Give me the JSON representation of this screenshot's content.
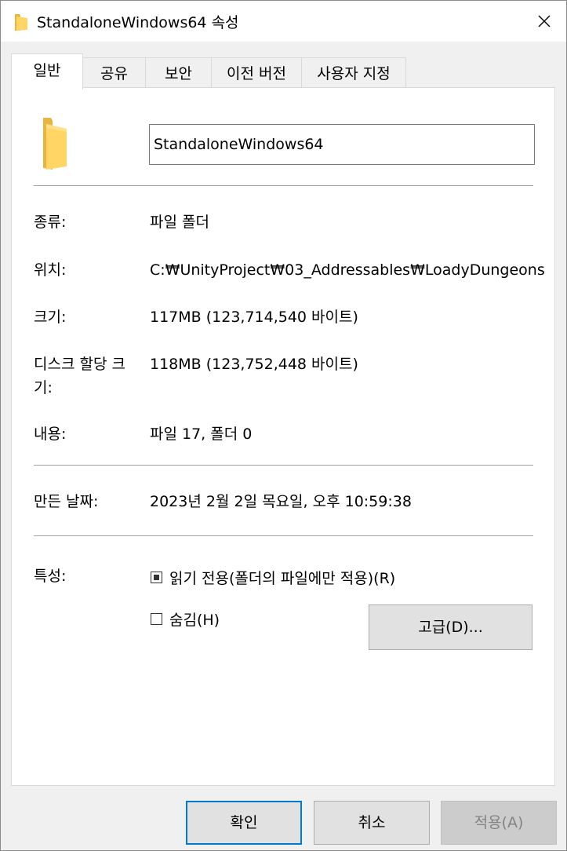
{
  "window": {
    "title": "StandaloneWindows64 속성",
    "close_icon": "close-icon"
  },
  "tabs": [
    {
      "label": "일반",
      "active": true
    },
    {
      "label": "공유",
      "active": false
    },
    {
      "label": "보안",
      "active": false
    },
    {
      "label": "이전 버전",
      "active": false
    },
    {
      "label": "사용자 지정",
      "active": false
    }
  ],
  "general": {
    "folder_icon": "folder-icon",
    "name_value": "StandaloneWindows64",
    "type_label": "종류:",
    "type_value": "파일 폴더",
    "location_label": "위치:",
    "location_value": "C:₩UnityProject₩03_Addressables₩LoadyDungeons",
    "size_label": "크기:",
    "size_value": "117MB (123,714,540 바이트)",
    "size_on_disk_label": "디스크 할당 크기:",
    "size_on_disk_value": "118MB (123,752,448 바이트)",
    "contents_label": "내용:",
    "contents_value": "파일 17, 폴더 0",
    "created_label": "만든 날짜:",
    "created_value": "2023년 2월 2일 목요일, 오후 10:59:38",
    "attributes_label": "특성:",
    "readonly_label": "읽기 전용(폴더의 파일에만 적용)(R)",
    "readonly_state": "indeterminate",
    "hidden_label": "숨김(H)",
    "hidden_checked": false,
    "advanced_button": "고급(D)..."
  },
  "footer": {
    "ok": "확인",
    "cancel": "취소",
    "apply": "적용(A)",
    "apply_enabled": false
  },
  "colors": {
    "folder_yellow": "#ffd566",
    "folder_dark": "#e8b640",
    "accent": "#0078d7"
  }
}
